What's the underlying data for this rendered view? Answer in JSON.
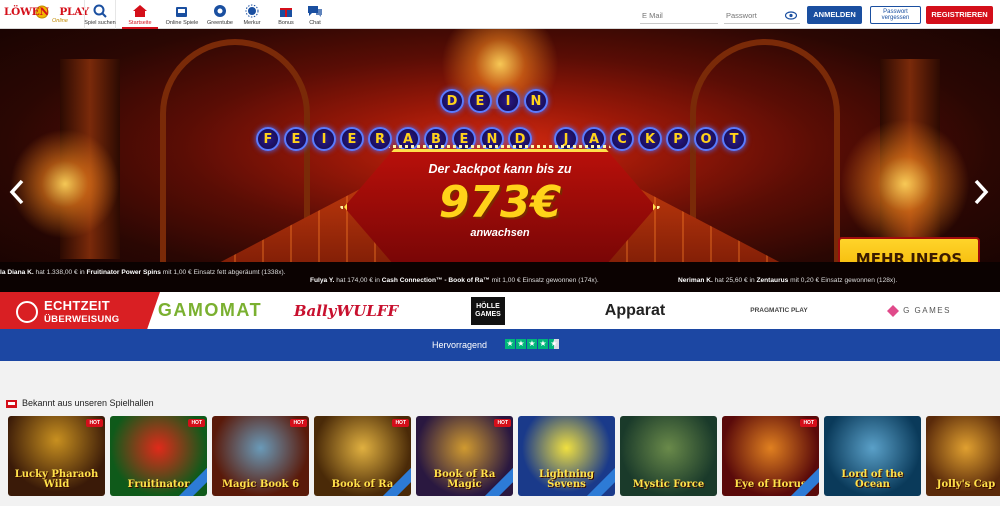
{
  "header": {
    "logo": {
      "name": "LÖWEN",
      "mark": "PLAY",
      "sub": "Online"
    },
    "nav": [
      {
        "label": "Spiel suchen",
        "icon": "search-icon"
      },
      {
        "label": "Startseite",
        "icon": "home-icon",
        "active": true
      },
      {
        "label": "Online Spiele",
        "icon": "slot-machine-icon"
      },
      {
        "label": "Greentube",
        "icon": "greentube-icon"
      },
      {
        "label": "Merkur",
        "icon": "sun-icon"
      },
      {
        "label": "Bonus",
        "icon": "gift-icon"
      },
      {
        "label": "Chat",
        "icon": "chat-icon"
      }
    ],
    "email_placeholder": "E Mail",
    "password_placeholder": "Passwort",
    "login_label": "ANMELDEN",
    "forgot_label": "Passwort vergessen",
    "register_label": "REGISTRIEREN"
  },
  "hero": {
    "line1": [
      "D",
      "E",
      "I",
      "N"
    ],
    "line2": [
      "F",
      "E",
      "I",
      "E",
      "R",
      "A",
      "B",
      "E",
      "N",
      "D",
      "J",
      "A",
      "C",
      "K",
      "P",
      "O",
      "T"
    ],
    "sign_top": "Der Jackpot kann bis zu",
    "amount": "973€",
    "sign_bottom": "anwachsen",
    "more_button": "MEHR INFOS"
  },
  "ticker": [
    {
      "name": "la Diana K.",
      "amount": "1.338,00 €",
      "game": "Fruitinator Power Spins",
      "stake": "1,00 €",
      "tail": "Einsatz fett abgeräumt (1338x)."
    },
    {
      "name": "Fulya Y.",
      "amount": "174,00 €",
      "game": "Cash Connection™ - Book of Ra™",
      "stake": "1,00 €",
      "tail": "Einsatz gewonnen (174x)."
    },
    {
      "name": "Neriman K.",
      "amount": "25,60 €",
      "game": "Zentaurus",
      "stake": "0,20 €",
      "tail": "Einsatz gewonnen (128x)."
    }
  ],
  "providers": {
    "echtzeit_line1": "ECHTZEIT",
    "echtzeit_line2": "ÜBERWEISUNG",
    "gamomat": "GAMOMAT",
    "bally": "BallyWULFF",
    "holle_line1": "HÖLLE",
    "holle_line2": "GAMES",
    "apparat": "Apparat",
    "pragmatic": "PRAGMATIC PLAY",
    "ggames": "G GAMES"
  },
  "trustpilot": {
    "label": "Hervorragend",
    "rating": 4.5
  },
  "section": {
    "title": "Bekannt aus unseren Spielhallen"
  },
  "games": [
    {
      "name": "Lucky Pharaoh Wild",
      "badge": "HOT",
      "bg": "#3a1a08"
    },
    {
      "name": "Fruitinator",
      "badge": "HOT",
      "bg": "#0f5a1a"
    },
    {
      "name": "Magic Book 6",
      "badge": "HOT",
      "bg": "#5a1a0a"
    },
    {
      "name": "Book of Ra",
      "badge": "HOT",
      "bg": "#4a2a08"
    },
    {
      "name": "Book of Ra Magic",
      "badge": "HOT",
      "bg": "#2a1840"
    },
    {
      "name": "Lightning Sevens",
      "badge": "",
      "bg": "#1a3a8a"
    },
    {
      "name": "Mystic Force",
      "badge": "",
      "bg": "#1a3a2a"
    },
    {
      "name": "Eye of Horus",
      "badge": "HOT",
      "bg": "#5a0a0a"
    },
    {
      "name": "Lord of the Ocean",
      "badge": "",
      "bg": "#0a3a5a"
    },
    {
      "name": "Jolly's Cap",
      "badge": "",
      "bg": "#5a2a0a"
    }
  ]
}
